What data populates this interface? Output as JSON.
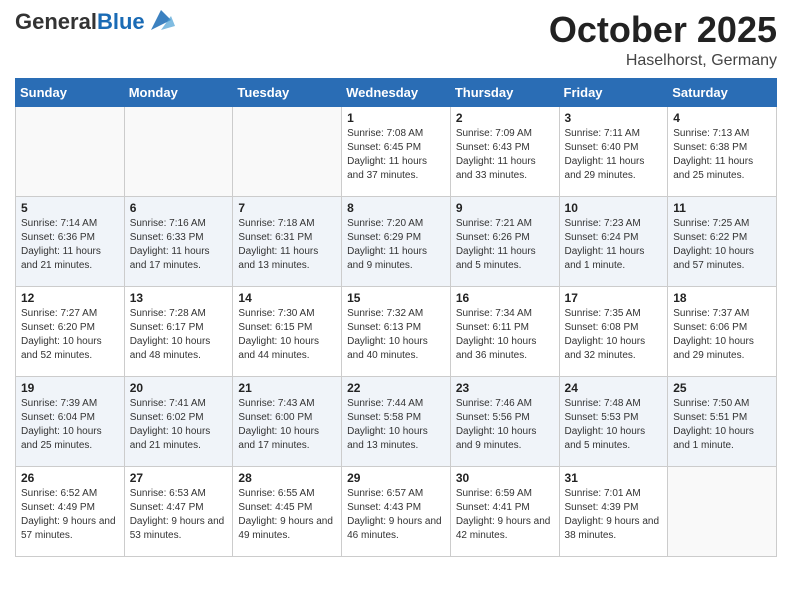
{
  "header": {
    "logo_general": "General",
    "logo_blue": "Blue",
    "month": "October 2025",
    "location": "Haselhorst, Germany"
  },
  "weekdays": [
    "Sunday",
    "Monday",
    "Tuesday",
    "Wednesday",
    "Thursday",
    "Friday",
    "Saturday"
  ],
  "weeks": [
    [
      {
        "day": "",
        "sunrise": "",
        "sunset": "",
        "daylight": ""
      },
      {
        "day": "",
        "sunrise": "",
        "sunset": "",
        "daylight": ""
      },
      {
        "day": "",
        "sunrise": "",
        "sunset": "",
        "daylight": ""
      },
      {
        "day": "1",
        "sunrise": "Sunrise: 7:08 AM",
        "sunset": "Sunset: 6:45 PM",
        "daylight": "Daylight: 11 hours and 37 minutes."
      },
      {
        "day": "2",
        "sunrise": "Sunrise: 7:09 AM",
        "sunset": "Sunset: 6:43 PM",
        "daylight": "Daylight: 11 hours and 33 minutes."
      },
      {
        "day": "3",
        "sunrise": "Sunrise: 7:11 AM",
        "sunset": "Sunset: 6:40 PM",
        "daylight": "Daylight: 11 hours and 29 minutes."
      },
      {
        "day": "4",
        "sunrise": "Sunrise: 7:13 AM",
        "sunset": "Sunset: 6:38 PM",
        "daylight": "Daylight: 11 hours and 25 minutes."
      }
    ],
    [
      {
        "day": "5",
        "sunrise": "Sunrise: 7:14 AM",
        "sunset": "Sunset: 6:36 PM",
        "daylight": "Daylight: 11 hours and 21 minutes."
      },
      {
        "day": "6",
        "sunrise": "Sunrise: 7:16 AM",
        "sunset": "Sunset: 6:33 PM",
        "daylight": "Daylight: 11 hours and 17 minutes."
      },
      {
        "day": "7",
        "sunrise": "Sunrise: 7:18 AM",
        "sunset": "Sunset: 6:31 PM",
        "daylight": "Daylight: 11 hours and 13 minutes."
      },
      {
        "day": "8",
        "sunrise": "Sunrise: 7:20 AM",
        "sunset": "Sunset: 6:29 PM",
        "daylight": "Daylight: 11 hours and 9 minutes."
      },
      {
        "day": "9",
        "sunrise": "Sunrise: 7:21 AM",
        "sunset": "Sunset: 6:26 PM",
        "daylight": "Daylight: 11 hours and 5 minutes."
      },
      {
        "day": "10",
        "sunrise": "Sunrise: 7:23 AM",
        "sunset": "Sunset: 6:24 PM",
        "daylight": "Daylight: 11 hours and 1 minute."
      },
      {
        "day": "11",
        "sunrise": "Sunrise: 7:25 AM",
        "sunset": "Sunset: 6:22 PM",
        "daylight": "Daylight: 10 hours and 57 minutes."
      }
    ],
    [
      {
        "day": "12",
        "sunrise": "Sunrise: 7:27 AM",
        "sunset": "Sunset: 6:20 PM",
        "daylight": "Daylight: 10 hours and 52 minutes."
      },
      {
        "day": "13",
        "sunrise": "Sunrise: 7:28 AM",
        "sunset": "Sunset: 6:17 PM",
        "daylight": "Daylight: 10 hours and 48 minutes."
      },
      {
        "day": "14",
        "sunrise": "Sunrise: 7:30 AM",
        "sunset": "Sunset: 6:15 PM",
        "daylight": "Daylight: 10 hours and 44 minutes."
      },
      {
        "day": "15",
        "sunrise": "Sunrise: 7:32 AM",
        "sunset": "Sunset: 6:13 PM",
        "daylight": "Daylight: 10 hours and 40 minutes."
      },
      {
        "day": "16",
        "sunrise": "Sunrise: 7:34 AM",
        "sunset": "Sunset: 6:11 PM",
        "daylight": "Daylight: 10 hours and 36 minutes."
      },
      {
        "day": "17",
        "sunrise": "Sunrise: 7:35 AM",
        "sunset": "Sunset: 6:08 PM",
        "daylight": "Daylight: 10 hours and 32 minutes."
      },
      {
        "day": "18",
        "sunrise": "Sunrise: 7:37 AM",
        "sunset": "Sunset: 6:06 PM",
        "daylight": "Daylight: 10 hours and 29 minutes."
      }
    ],
    [
      {
        "day": "19",
        "sunrise": "Sunrise: 7:39 AM",
        "sunset": "Sunset: 6:04 PM",
        "daylight": "Daylight: 10 hours and 25 minutes."
      },
      {
        "day": "20",
        "sunrise": "Sunrise: 7:41 AM",
        "sunset": "Sunset: 6:02 PM",
        "daylight": "Daylight: 10 hours and 21 minutes."
      },
      {
        "day": "21",
        "sunrise": "Sunrise: 7:43 AM",
        "sunset": "Sunset: 6:00 PM",
        "daylight": "Daylight: 10 hours and 17 minutes."
      },
      {
        "day": "22",
        "sunrise": "Sunrise: 7:44 AM",
        "sunset": "Sunset: 5:58 PM",
        "daylight": "Daylight: 10 hours and 13 minutes."
      },
      {
        "day": "23",
        "sunrise": "Sunrise: 7:46 AM",
        "sunset": "Sunset: 5:56 PM",
        "daylight": "Daylight: 10 hours and 9 minutes."
      },
      {
        "day": "24",
        "sunrise": "Sunrise: 7:48 AM",
        "sunset": "Sunset: 5:53 PM",
        "daylight": "Daylight: 10 hours and 5 minutes."
      },
      {
        "day": "25",
        "sunrise": "Sunrise: 7:50 AM",
        "sunset": "Sunset: 5:51 PM",
        "daylight": "Daylight: 10 hours and 1 minute."
      }
    ],
    [
      {
        "day": "26",
        "sunrise": "Sunrise: 6:52 AM",
        "sunset": "Sunset: 4:49 PM",
        "daylight": "Daylight: 9 hours and 57 minutes."
      },
      {
        "day": "27",
        "sunrise": "Sunrise: 6:53 AM",
        "sunset": "Sunset: 4:47 PM",
        "daylight": "Daylight: 9 hours and 53 minutes."
      },
      {
        "day": "28",
        "sunrise": "Sunrise: 6:55 AM",
        "sunset": "Sunset: 4:45 PM",
        "daylight": "Daylight: 9 hours and 49 minutes."
      },
      {
        "day": "29",
        "sunrise": "Sunrise: 6:57 AM",
        "sunset": "Sunset: 4:43 PM",
        "daylight": "Daylight: 9 hours and 46 minutes."
      },
      {
        "day": "30",
        "sunrise": "Sunrise: 6:59 AM",
        "sunset": "Sunset: 4:41 PM",
        "daylight": "Daylight: 9 hours and 42 minutes."
      },
      {
        "day": "31",
        "sunrise": "Sunrise: 7:01 AM",
        "sunset": "Sunset: 4:39 PM",
        "daylight": "Daylight: 9 hours and 38 minutes."
      },
      {
        "day": "",
        "sunrise": "",
        "sunset": "",
        "daylight": ""
      }
    ]
  ]
}
